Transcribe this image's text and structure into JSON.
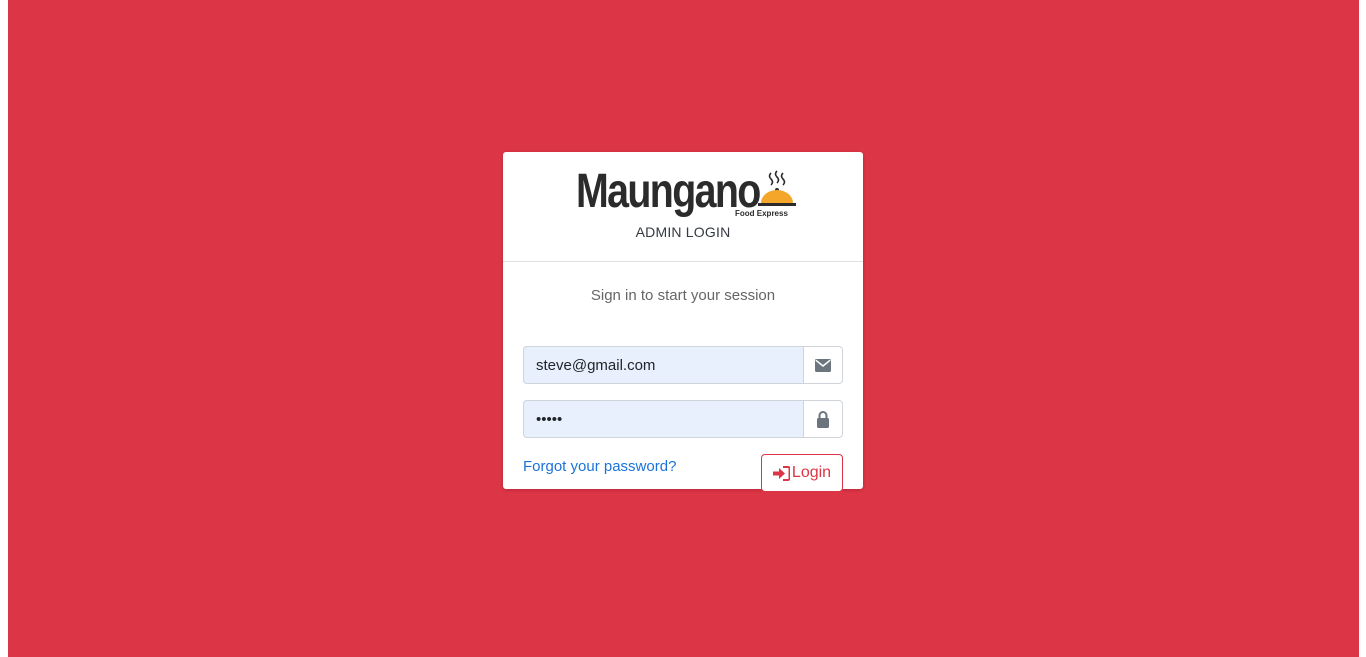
{
  "brand": {
    "name": "Maungano",
    "tagline": "Food Express",
    "accent_color": "#f4a62a"
  },
  "header": {
    "title": "ADMIN LOGIN"
  },
  "form": {
    "session_message": "Sign in to start your session",
    "email": {
      "value": "steve@gmail.com",
      "icon": "envelope-icon"
    },
    "password": {
      "value": "•••••",
      "icon": "lock-icon"
    },
    "forgot_link": "Forgot your password?",
    "login_button": {
      "label": "Login",
      "icon": "sign-in-icon"
    }
  },
  "colors": {
    "background": "#dc3545",
    "primary_link": "#1a73d9",
    "autofill": "#e8f0fe"
  }
}
